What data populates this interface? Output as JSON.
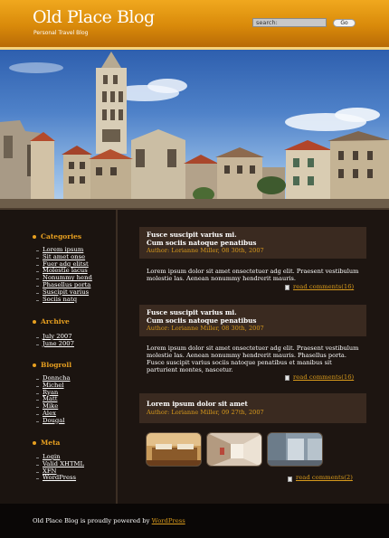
{
  "header": {
    "site_title": "Old Place Blog",
    "tagline": "Personal Travel Blog",
    "search_label": "search:",
    "go_label": "Go"
  },
  "sidebar": {
    "categories": {
      "heading": "Categories",
      "items": [
        "Lorem ipsum",
        "Sit amet onse",
        "Fuer adg elitst",
        "Molestie lacus",
        "Nonummy hend",
        "Phasellus porta",
        "Suscipit varius",
        "Sociis natq"
      ]
    },
    "archive": {
      "heading": "Archive",
      "items": [
        "July 2007",
        "June 2007"
      ]
    },
    "blogroll": {
      "heading": "Blogroll",
      "items": [
        "Donncha",
        "Michel",
        "Ryan",
        "Matt",
        "Mike",
        "Alex",
        "Dougal"
      ]
    },
    "meta": {
      "heading": "Meta",
      "items": [
        "Login",
        "Valid XHTML",
        "XFN",
        "WordPress"
      ]
    }
  },
  "posts": [
    {
      "title_line1": "Fusce suscipit varius mi.",
      "title_line2": "Cum sociis natoque penatibus",
      "meta": "Author: Lorianne Miller, 08 30th, 2007",
      "body": "Lorem ipsum dolor sit amet onsectetuer adg elit. Praesent vestibulum molestie las. Aenean nonummy hendrerit mauris.",
      "comments": "read comments(16)"
    },
    {
      "title_line1": "Fusce suscipit varius mi.",
      "title_line2": "Cum sociis natoque penatibus",
      "meta": "Author: Lorianne Miller, 08 30th, 2007",
      "body": "Lorem ipsum dolor sit amet onsectetuer adg elit. Praesent vestibulum molestie las. Aenean nonummy hendrerit mauris. Phasellus porta. Fusce suscipit varius sociis natoque penatibus et manibus sit parturient montes, nascetur.",
      "comments": "read comments(16)"
    },
    {
      "title_line1": "Lorem ipsum dolor sit amet",
      "meta": "Author: Lorianne Miller, 09 27th, 2007",
      "comments": "read comments(2)"
    }
  ],
  "footer": {
    "text": "Old Place Blog is proudly powered by",
    "link": "WordPress"
  },
  "colors": {
    "header_orange": "#e0940f",
    "accent": "#d89a1c",
    "background": "#1e1612",
    "post_header": "#3a2a20"
  },
  "icons": [
    "comment-page-icon",
    "list-bullet-icon"
  ]
}
